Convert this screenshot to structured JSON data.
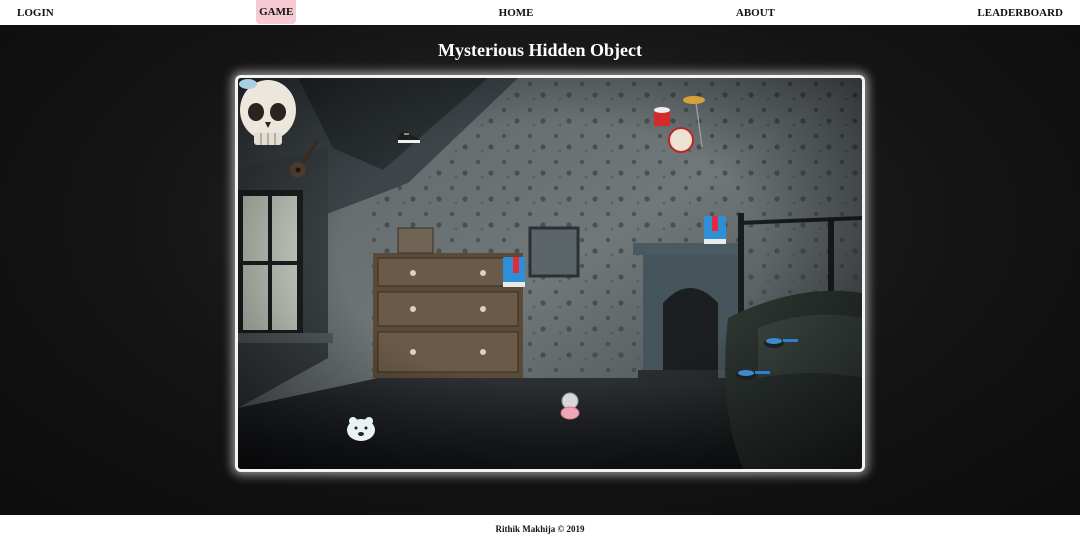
{
  "nav": {
    "login": "LOGIN",
    "game": "GAME",
    "home": "HOME",
    "about": "ABOUT",
    "leaderboard": "LEADERBOARD"
  },
  "page": {
    "title": "Mysterious Hidden Object"
  },
  "footer": {
    "credit": "Rithik Makhija © 2019"
  },
  "hidden_objects": [
    "skull",
    "sneaker",
    "guitar",
    "drum-kit",
    "book",
    "book",
    "frying-pan",
    "frying-pan",
    "compact-mirror",
    "polar-bear"
  ],
  "colors": {
    "accent_nav": "#f7c9d3",
    "frame_border": "#f3f3f3",
    "background": "#111111"
  }
}
